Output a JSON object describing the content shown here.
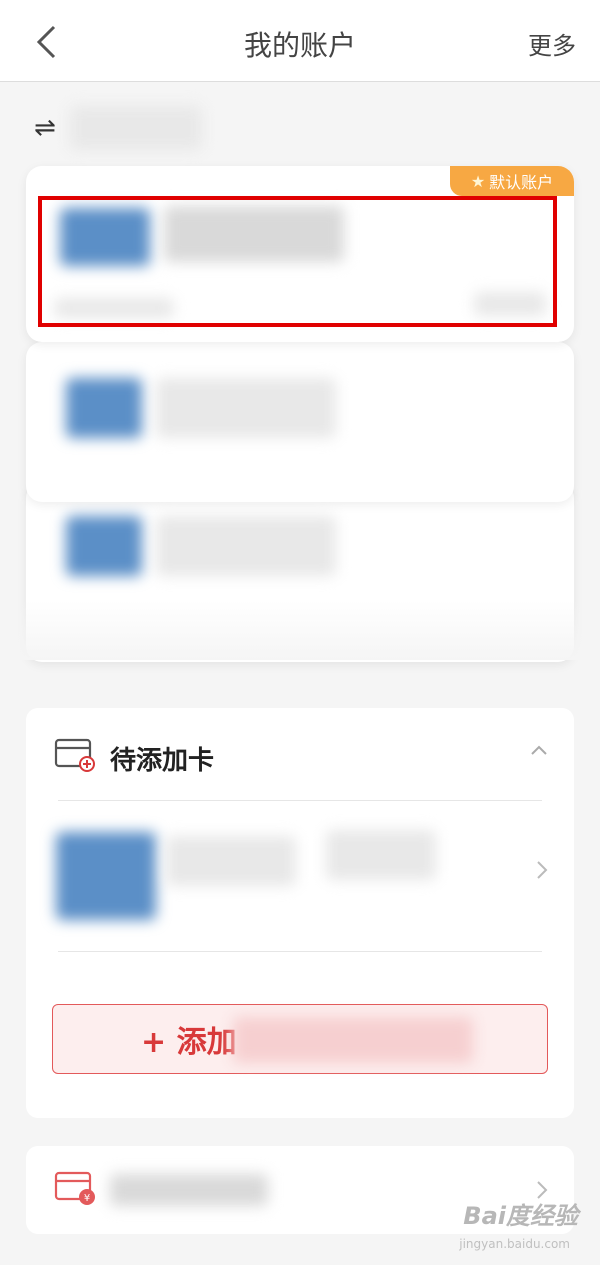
{
  "header": {
    "title": "我的账户",
    "more_label": "更多",
    "back_icon": "chevron-left-icon"
  },
  "account_switch": {
    "icon": "swap-arrows-icon",
    "glyph": "⇌"
  },
  "default_card": {
    "badge_label": "默认账户",
    "badge_icon": "star-icon",
    "badge_color": "#f7a843"
  },
  "pending_section": {
    "title": "待添加卡",
    "add_button_label": "+ 添加"
  },
  "watermark": {
    "text": "Bai度经验",
    "sub": "jingyan.baidu.com"
  },
  "colors": {
    "highlight": "#e00000",
    "accent_red": "#d8393a",
    "button_bg": "#fdeeee"
  }
}
